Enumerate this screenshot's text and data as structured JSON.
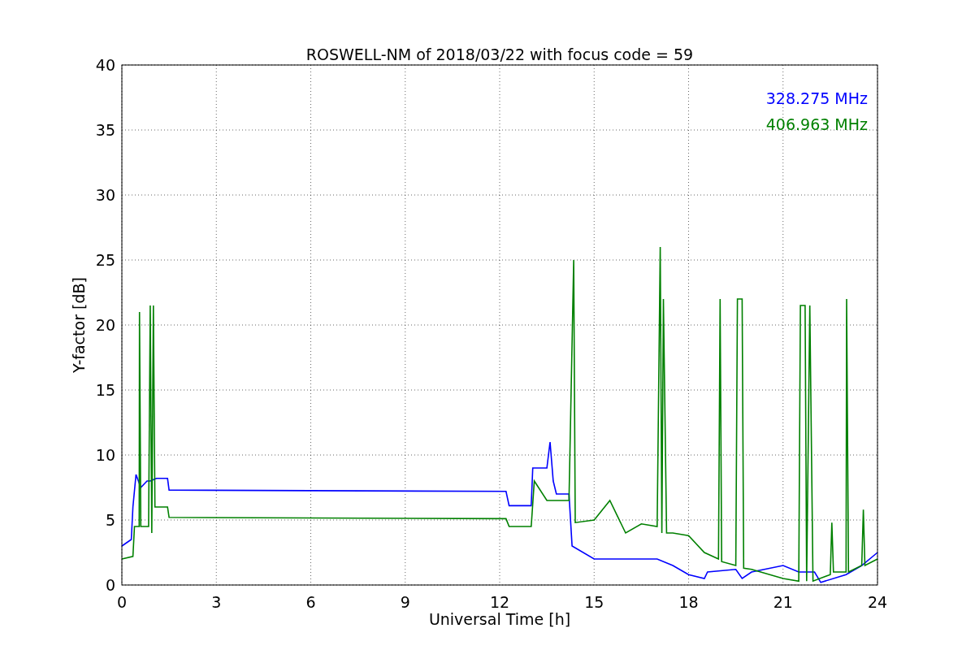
{
  "chart_data": {
    "type": "line",
    "title": "ROSWELL-NM of 2018/03/22 with focus code = 59",
    "xlabel": "Universal Time [h]",
    "ylabel": "Y-factor [dB]",
    "xlim": [
      0,
      24
    ],
    "ylim": [
      0,
      40
    ],
    "xticks": [
      0,
      3,
      6,
      9,
      12,
      15,
      18,
      21,
      24
    ],
    "yticks": [
      0,
      5,
      10,
      15,
      20,
      25,
      30,
      35,
      40
    ],
    "grid": true,
    "series": [
      {
        "name": "328.275 MHz",
        "color": "#0000ff",
        "x": [
          0,
          0.3,
          0.35,
          0.45,
          0.6,
          0.8,
          0.9,
          1.1,
          1.45,
          1.5,
          12.2,
          12.3,
          13.0,
          13.05,
          13.5,
          13.6,
          13.7,
          13.8,
          14.2,
          14.3,
          15,
          16,
          17,
          17.5,
          18,
          18.5,
          18.6,
          19.5,
          19.7,
          20,
          21,
          21.5,
          22,
          22.2,
          23,
          23.5,
          24
        ],
        "values": [
          3,
          3.5,
          6,
          8.5,
          7.5,
          8,
          8,
          8.2,
          8.2,
          7.3,
          7.2,
          6.1,
          6.1,
          9,
          9,
          11,
          8,
          7,
          7,
          3,
          2,
          2,
          2,
          1.5,
          0.8,
          0.5,
          1,
          1.2,
          0.5,
          1,
          1.5,
          1,
          1,
          0.2,
          0.8,
          1.5,
          2.5
        ]
      },
      {
        "name": "406.963 MHz",
        "color": "#008000",
        "x": [
          0,
          0.35,
          0.4,
          0.55,
          0.56,
          0.6,
          0.85,
          0.9,
          0.95,
          1,
          1.05,
          1.45,
          1.5,
          12.2,
          12.3,
          13,
          13.1,
          13.5,
          14.2,
          14.35,
          14.4,
          15,
          15.5,
          16,
          16.5,
          17,
          17.1,
          17.15,
          17.2,
          17.3,
          17.5,
          18,
          18.5,
          18.95,
          19,
          19.05,
          19.5,
          19.55,
          19.7,
          19.75,
          20,
          21,
          21.5,
          21.55,
          21.7,
          21.75,
          21.85,
          21.95,
          22.5,
          22.55,
          22.6,
          23,
          23.02,
          23.08,
          23.5,
          23.55,
          23.6,
          24
        ],
        "values": [
          2,
          2.2,
          4.5,
          4.5,
          21,
          4.5,
          4.5,
          21.5,
          4,
          21.5,
          6,
          6,
          5.2,
          5.1,
          4.5,
          4.5,
          8,
          6.5,
          6.5,
          25,
          4.8,
          5,
          6.5,
          4,
          4.7,
          4.5,
          26,
          4,
          22,
          4,
          4,
          3.8,
          2.5,
          2,
          22,
          1.8,
          1.5,
          22,
          22,
          1.3,
          1.2,
          0.5,
          0.3,
          21.5,
          21.5,
          0.3,
          21.5,
          0.3,
          0.8,
          4.8,
          1,
          1,
          22,
          1,
          1.5,
          5.8,
          1.5,
          2
        ]
      }
    ]
  }
}
